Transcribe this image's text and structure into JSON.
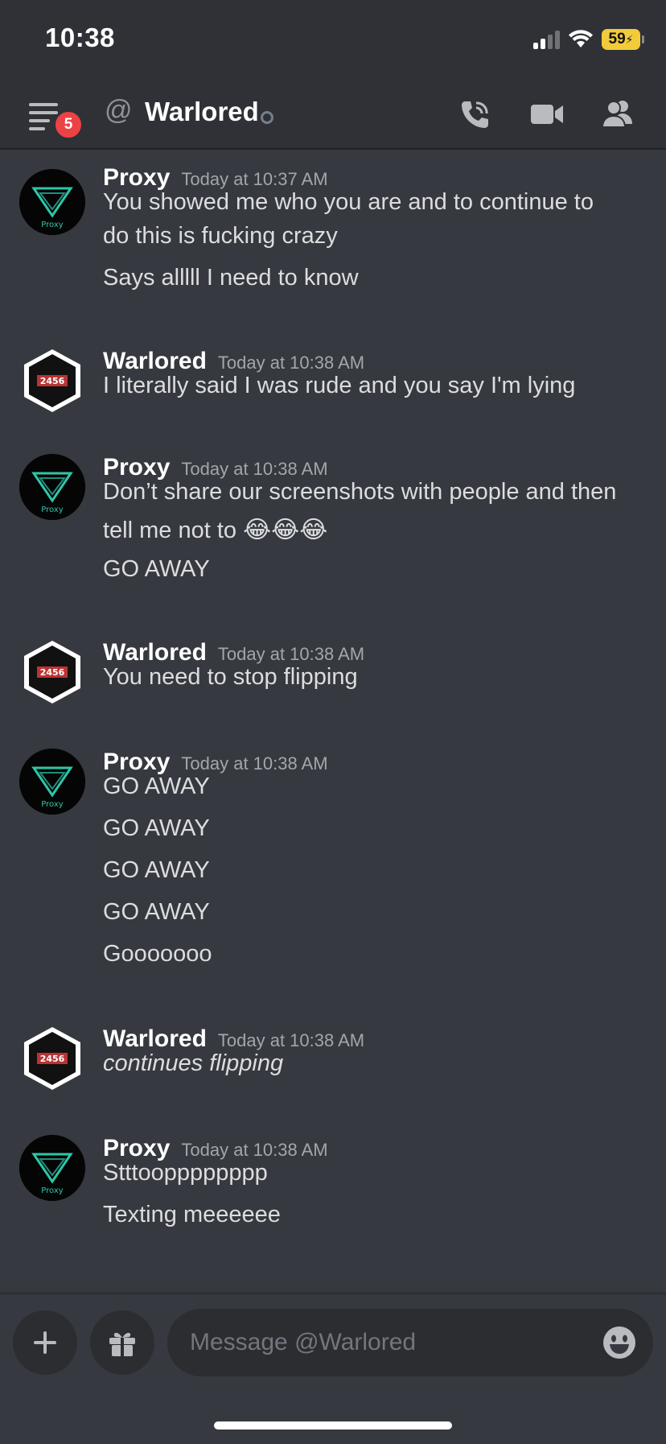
{
  "status_bar": {
    "time": "10:38",
    "battery": "59"
  },
  "header": {
    "menu_badge": "5",
    "at_symbol": "@",
    "title": "Warlored",
    "icons": [
      "phone-icon",
      "video-icon",
      "members-icon"
    ]
  },
  "messages": [
    {
      "author": "Proxy",
      "timestamp": "Today at 10:37 AM",
      "avatar": "proxy-avatar",
      "lines": [
        "You showed me who you are and to continue to",
        "do this is fucking crazy",
        "Says alllll I need to know"
      ]
    },
    {
      "author": "Warlored",
      "timestamp": "Today at 10:38 AM",
      "avatar": "warlored-avatar",
      "lines": [
        "I literally said I was rude and you say I'm lying"
      ]
    },
    {
      "author": "Proxy",
      "timestamp": "Today at 10:38 AM",
      "avatar": "proxy-avatar",
      "lines": [
        "Don’t share our screenshots with people and then",
        "tell me not to",
        "GO AWAY"
      ],
      "emoji": "😂😂😂"
    },
    {
      "author": "Warlored",
      "timestamp": "Today at 10:38 AM",
      "avatar": "warlored-avatar",
      "lines": [
        "You need to stop flipping"
      ]
    },
    {
      "author": "Proxy",
      "timestamp": "Today at 10:38 AM",
      "avatar": "proxy-avatar",
      "lines": [
        "GO AWAY",
        "GO AWAY",
        "GO AWAY",
        "GO AWAY",
        "Gooooooo"
      ]
    },
    {
      "author": "Warlored",
      "timestamp": "Today at 10:38 AM",
      "avatar": "warlored-avatar",
      "lines": [
        "continues flipping"
      ]
    },
    {
      "author": "Proxy",
      "timestamp": "Today at 10:38 AM",
      "avatar": "proxy-avatar",
      "lines": [
        "Stttoopppppppp",
        "Texting meeeeee"
      ]
    }
  ],
  "composer": {
    "placeholder": "Message @Warlored",
    "icons": [
      "plus-icon",
      "gift-icon",
      "emoji-icon"
    ]
  },
  "avatar_text": {
    "proxy": "Proxy",
    "warlored": "2456"
  }
}
